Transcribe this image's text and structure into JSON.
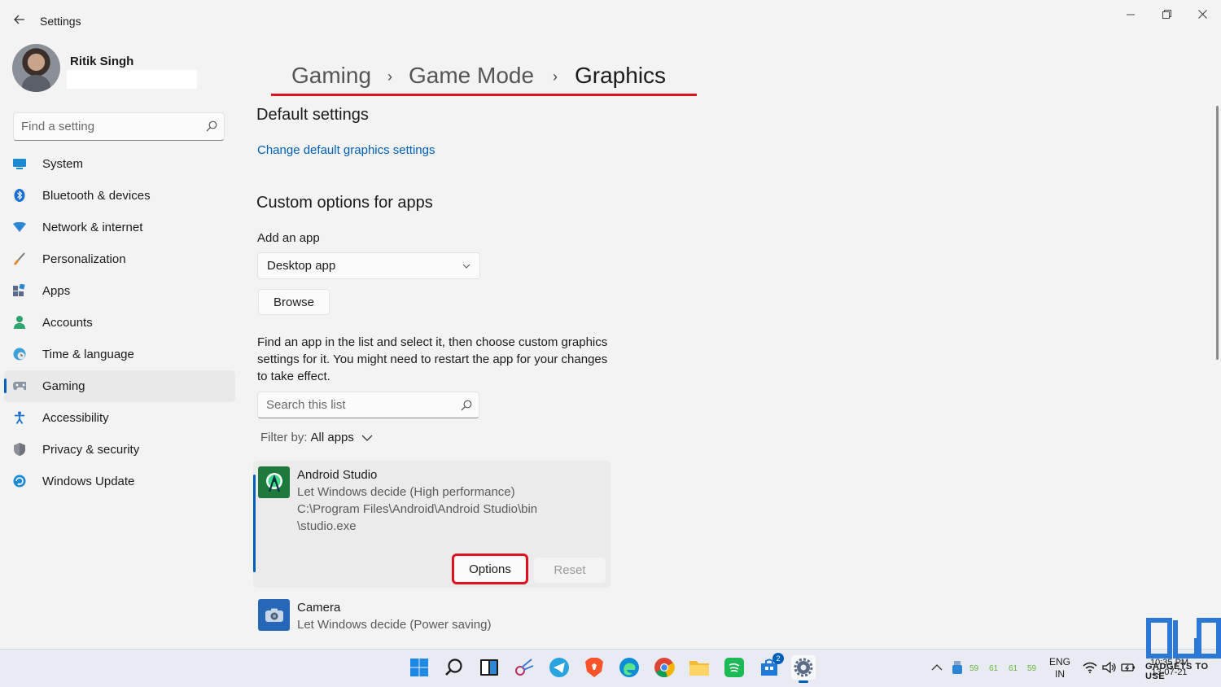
{
  "window": {
    "title": "Settings",
    "back": "←",
    "controls": [
      "—",
      "❐",
      "✕"
    ]
  },
  "user": {
    "name": "Ritik Singh"
  },
  "search": {
    "placeholder": "Find a setting"
  },
  "nav": {
    "items": [
      {
        "label": "System",
        "icon": "system-icon"
      },
      {
        "label": "Bluetooth & devices",
        "icon": "bluetooth-icon"
      },
      {
        "label": "Network & internet",
        "icon": "wifi-icon"
      },
      {
        "label": "Personalization",
        "icon": "brush-icon"
      },
      {
        "label": "Apps",
        "icon": "apps-icon"
      },
      {
        "label": "Accounts",
        "icon": "person-icon"
      },
      {
        "label": "Time & language",
        "icon": "globe-clock-icon"
      },
      {
        "label": "Gaming",
        "icon": "gamepad-icon",
        "active": true
      },
      {
        "label": "Accessibility",
        "icon": "accessibility-icon"
      },
      {
        "label": "Privacy & security",
        "icon": "shield-icon"
      },
      {
        "label": "Windows Update",
        "icon": "update-icon"
      }
    ]
  },
  "breadcrumb": {
    "items": [
      "Gaming",
      "Game Mode",
      "Graphics"
    ],
    "separator": "›"
  },
  "main": {
    "default_heading": "Default settings",
    "default_link": "Change default graphics settings",
    "custom_heading": "Custom options for apps",
    "add_app_label": "Add an app",
    "add_app_value": "Desktop app",
    "browse_label": "Browse",
    "description": "Find an app in the list and select it, then choose custom graphics settings for it. You might need to restart the app for your changes to take effect.",
    "list_search_placeholder": "Search this list",
    "filter_label": "Filter by:",
    "filter_value": "All apps"
  },
  "apps": [
    {
      "name": "Android Studio",
      "setting": "Let Windows decide (High performance)",
      "path_line1": "C:\\Program Files\\Android\\Android Studio\\bin",
      "path_line2": "\\studio.exe",
      "options_label": "Options",
      "reset_label": "Reset",
      "icon": "android-studio-icon",
      "selected": true
    },
    {
      "name": "Camera",
      "setting": "Let Windows decide (Power saving)",
      "icon": "camera-icon"
    }
  ],
  "taskbar": {
    "icons": [
      "start-icon",
      "search-icon",
      "task-view-icon",
      "snipping-tool-icon",
      "telegram-icon",
      "brave-icon",
      "edge-icon",
      "chrome-icon",
      "file-explorer-icon",
      "spotify-icon",
      "store-icon",
      "settings-icon"
    ],
    "store_badge": "2",
    "tray_numbers": [
      "59",
      "61",
      "61",
      "59"
    ],
    "lang_line1": "ENG",
    "lang_line2": "IN",
    "time": "10:35 PM",
    "date": "13-07-21",
    "watermark": "GADGETS TO USE"
  },
  "colors": {
    "accent": "#005fb8",
    "highlight_red": "#e0101f",
    "background": "#f3f3f3"
  }
}
